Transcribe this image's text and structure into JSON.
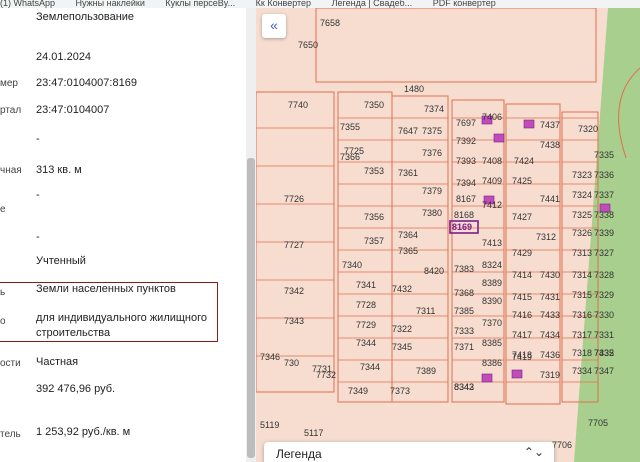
{
  "bookmarks": [
    "(1) WhatsApp",
    "Нужны наклейки",
    "Куклы персеBy...",
    "Кк Конвертер",
    "Легенда | Свадеб...",
    "PDF конвертер"
  ],
  "info_rows": [
    {
      "key": "purpose_top",
      "label": "",
      "value": "Землепользование"
    },
    {
      "key": "date",
      "label": "",
      "value": "24.01.2024"
    },
    {
      "key": "cad_number",
      "label": "мер",
      "value": "23:47:0104007:8169"
    },
    {
      "key": "quarter",
      "label": "ртал",
      "value": "23:47:0104007"
    },
    {
      "key": "dash1",
      "label": "",
      "value": "-"
    },
    {
      "key": "area",
      "label": "чная",
      "value": "313 кв. м"
    },
    {
      "key": "dash2",
      "label": "е",
      "value": "-"
    },
    {
      "key": "dash3",
      "label": "",
      "value": "-"
    },
    {
      "key": "status",
      "label": "",
      "value": "Учтенный"
    },
    {
      "key": "category",
      "label": "ь",
      "value": "Земли населенных пунктов"
    },
    {
      "key": "use_1",
      "label": "о",
      "value": "для индивидуального жилищного"
    },
    {
      "key": "use_2",
      "label": "",
      "value": "строительства"
    },
    {
      "key": "ownership",
      "label": "ости",
      "value": "Частная"
    },
    {
      "key": "cad_value",
      "label": "",
      "value": "392 476,96 руб."
    },
    {
      "key": "specific_value",
      "label": "тель",
      "value": "1 253,92 руб./кв. м"
    }
  ],
  "map": {
    "collapse_icon": "«",
    "legend_label": "Легенда",
    "legend_icon": "⌃⌄",
    "road_label": "1480",
    "parcels": [
      "7658",
      "7650",
      "7740",
      "7350",
      "7374",
      "7697",
      "7406",
      "7437",
      "7320",
      "7355",
      "7647",
      "7375",
      "7392",
      "7438",
      "7725",
      "7366",
      "7376",
      "7393",
      "7408",
      "7424",
      "7335",
      "7353",
      "7361",
      "7394",
      "7409",
      "7425",
      "7323",
      "7336",
      "7379",
      "8167",
      "7441",
      "7324",
      "7337",
      "7726",
      "7356",
      "7380",
      "8168",
      "7412",
      "7427",
      "7325",
      "7338",
      "7364",
      "8169",
      "7312",
      "7326",
      "7339",
      "7727",
      "7357",
      "7365",
      "7413",
      "7429",
      "7313",
      "7327",
      "7340",
      "8420",
      "7383",
      "8324",
      "7414",
      "7430",
      "7314",
      "7328",
      "7341",
      "7432",
      "7368",
      "8389",
      "7415",
      "7431",
      "7315",
      "7329",
      "7342",
      "7728",
      "7311",
      "7385",
      "8390",
      "7416",
      "7433",
      "7316",
      "7330",
      "7343",
      "7729",
      "7322",
      "7370",
      "7417",
      "7434",
      "7317",
      "7331",
      "7344",
      "7333",
      "8385",
      "7418",
      "7436",
      "7318",
      "7332",
      "7345",
      "7371",
      "8386",
      "7419",
      "7435",
      "7346",
      "730",
      "7731",
      "7344",
      "7389",
      "8342",
      "7319",
      "7334",
      "7347",
      "7732",
      "7349",
      "7373",
      "8343",
      "7705",
      "5119",
      "5117",
      "7706"
    ],
    "selected_parcel": "8169",
    "colors": {
      "bg": "#f6ddd0",
      "line": "#e0704e",
      "road": "#a8cf8e",
      "building": "#c04cb8",
      "selected": "#7a1f8f"
    }
  }
}
